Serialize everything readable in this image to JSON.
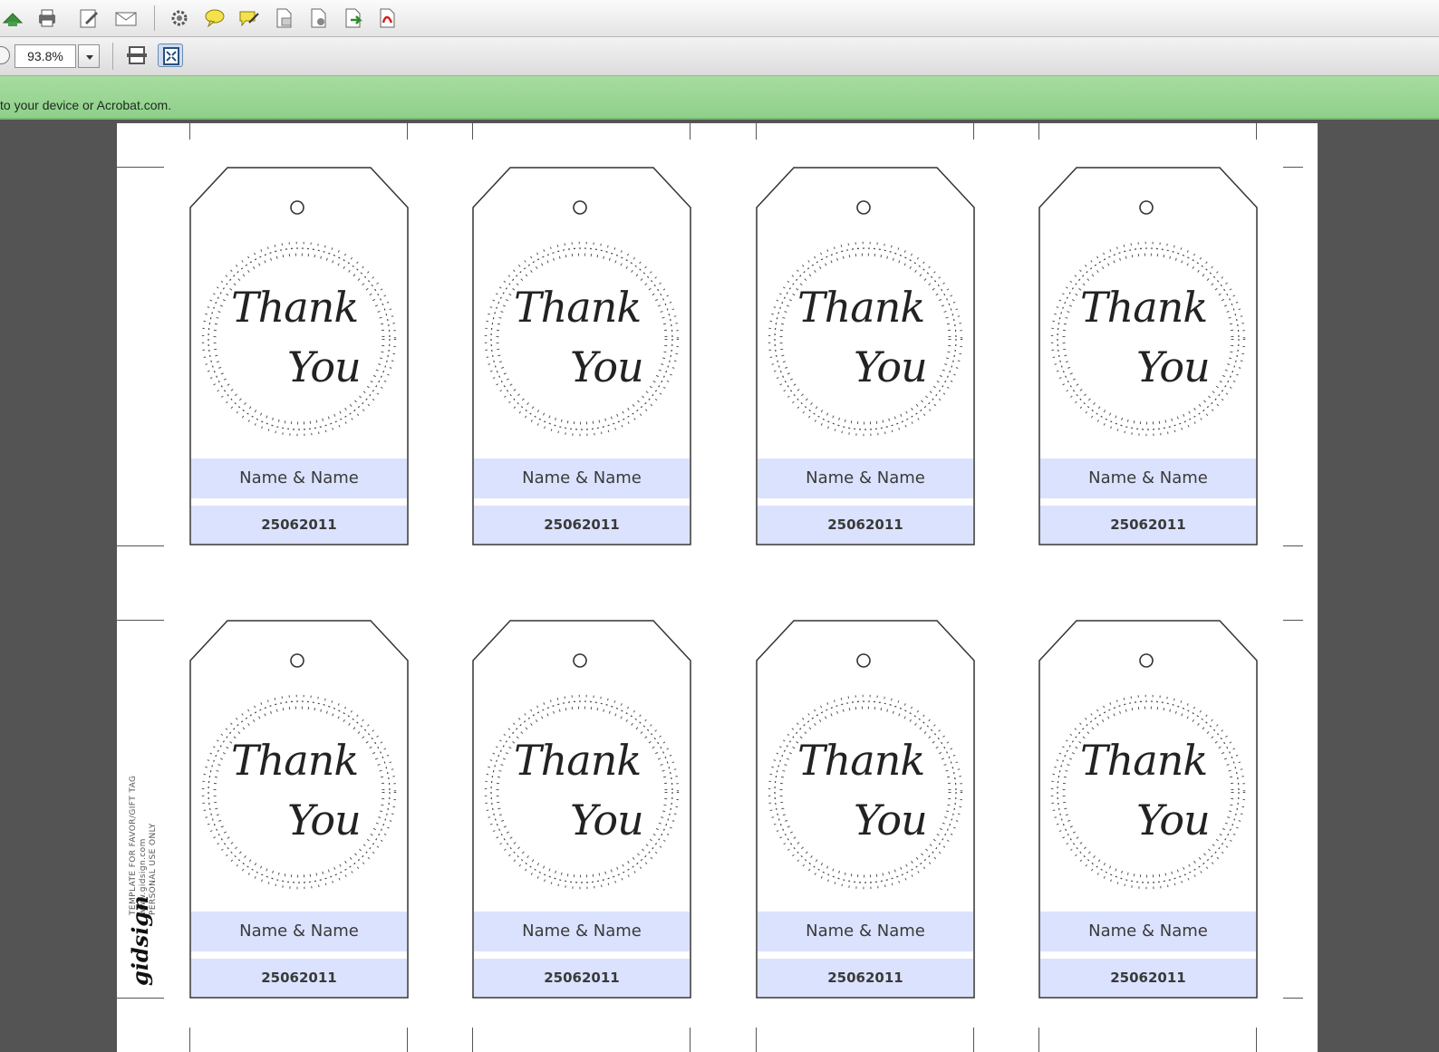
{
  "toolbar": {
    "buttons": [
      "share-icon",
      "print-icon",
      "edit-icon",
      "email-icon",
      "settings-icon",
      "comment-icon",
      "sign-icon",
      "document-icon",
      "document-settings-icon",
      "export-icon",
      "pdf-icon"
    ]
  },
  "view_toolbar": {
    "zoom_value": "93.8%",
    "buttons": [
      "fit-width-icon",
      "fit-page-icon"
    ]
  },
  "notification": {
    "text": "to your device or Acrobat.com."
  },
  "tags": [
    {
      "line1": "Thank",
      "line2": "You",
      "name": "Name & Name",
      "date": "25062011"
    },
    {
      "line1": "Thank",
      "line2": "You",
      "name": "Name & Name",
      "date": "25062011"
    },
    {
      "line1": "Thank",
      "line2": "You",
      "name": "Name & Name",
      "date": "25062011"
    },
    {
      "line1": "Thank",
      "line2": "You",
      "name": "Name & Name",
      "date": "25062011"
    },
    {
      "line1": "Thank",
      "line2": "You",
      "name": "Name & Name",
      "date": "25062011"
    },
    {
      "line1": "Thank",
      "line2": "You",
      "name": "Name & Name",
      "date": "25062011"
    },
    {
      "line1": "Thank",
      "line2": "You",
      "name": "Name & Name",
      "date": "25062011"
    },
    {
      "line1": "Thank",
      "line2": "You",
      "name": "Name & Name",
      "date": "25062011"
    }
  ],
  "side_note": {
    "line1": "TEMPLATE FOR FAVOR/GIFT TAG",
    "line2": "www.gidsign.com",
    "line3": "PERSONAL USE ONLY",
    "logo": "gidsign"
  }
}
